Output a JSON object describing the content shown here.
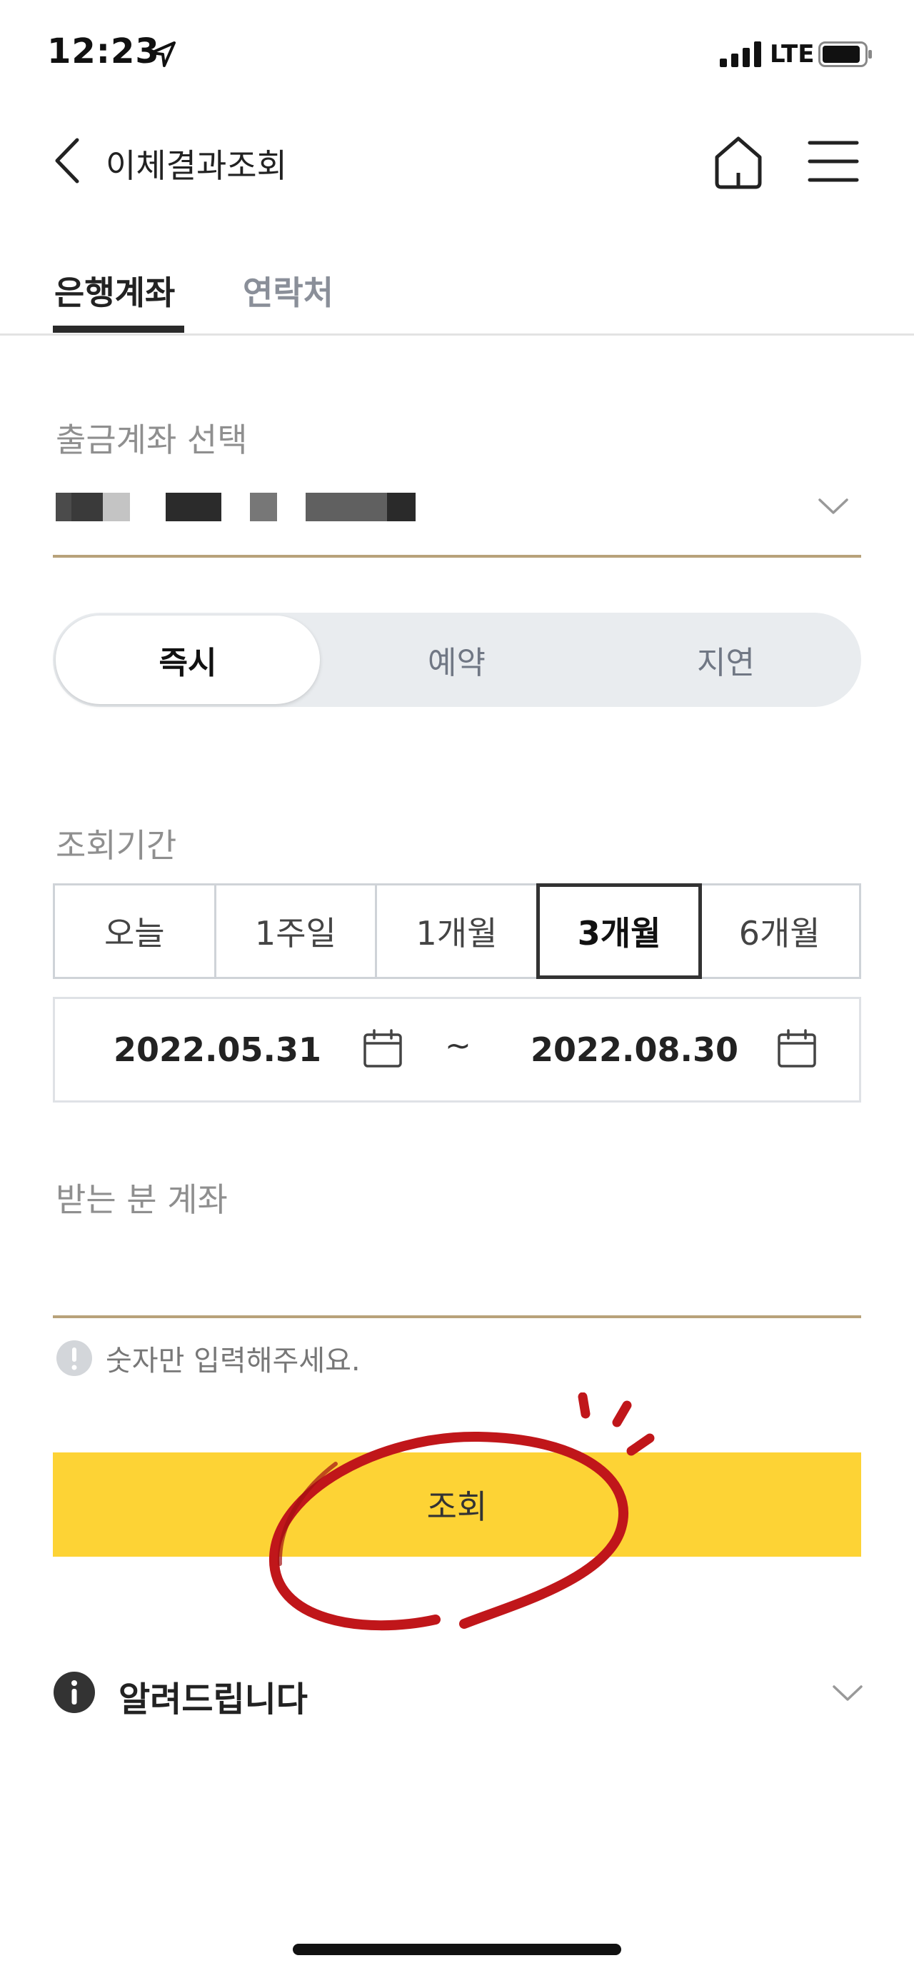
{
  "status_bar": {
    "time": "12:23",
    "network": "LTE"
  },
  "header": {
    "title": "이체결과조회"
  },
  "tabs": [
    {
      "label": "은행계좌",
      "active": true
    },
    {
      "label": "연락처",
      "active": false
    }
  ],
  "account": {
    "label": "출금계좌 선택"
  },
  "transfer_type": {
    "options": [
      "즉시",
      "예약",
      "지연"
    ],
    "selected": "즉시"
  },
  "period": {
    "label": "조회기간",
    "options": [
      "오늘",
      "1주일",
      "1개월",
      "3개월",
      "6개월"
    ],
    "selected": "3개월",
    "start_date": "2022.05.31",
    "separator": "~",
    "end_date": "2022.08.30"
  },
  "recipient": {
    "label": "받는 분 계좌",
    "value": "",
    "hint": "숫자만 입력해주세요."
  },
  "submit": {
    "label": "조회"
  },
  "notice": {
    "label": "알려드립니다"
  },
  "colors": {
    "accent_yellow": "#fdd335",
    "underline_gold": "#b8a27a",
    "annotation_red": "#c0161a"
  }
}
